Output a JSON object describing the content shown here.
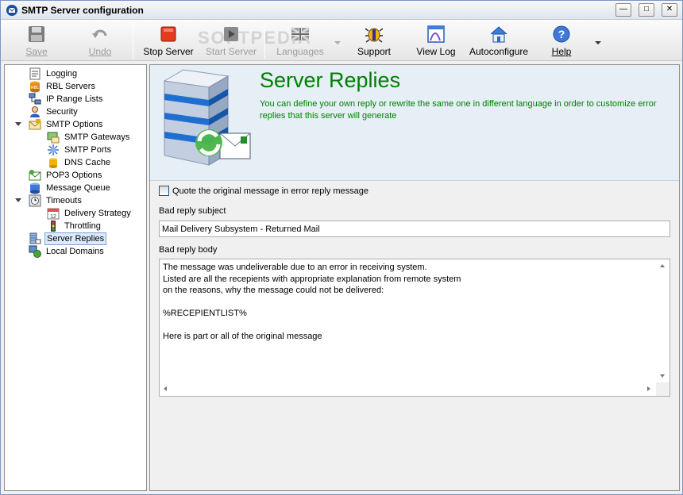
{
  "window": {
    "title": "SMTP Server configuration"
  },
  "toolbar": {
    "watermark": "SOFTPEDIA",
    "buttons": [
      {
        "id": "save",
        "label": "Save",
        "icon": "floppy-disk-icon",
        "enabled": false
      },
      {
        "id": "undo",
        "label": "Undo",
        "icon": "undo-arrow-icon",
        "enabled": false
      },
      {
        "id": "stop-server",
        "label": "Stop Server",
        "icon": "stop-icon",
        "enabled": true
      },
      {
        "id": "start-server",
        "label": "Start Server",
        "icon": "play-icon",
        "enabled": false
      },
      {
        "id": "languages",
        "label": "Languages",
        "icon": "uk-flag-icon",
        "enabled": false
      },
      {
        "id": "support",
        "label": "Support",
        "icon": "bug-icon",
        "enabled": true
      },
      {
        "id": "view-log",
        "label": "View Log",
        "icon": "log-window-icon",
        "enabled": true
      },
      {
        "id": "autoconfigure",
        "label": "Autoconfigure",
        "icon": "house-icon",
        "enabled": true
      },
      {
        "id": "help",
        "label": "Help",
        "icon": "help-icon",
        "enabled": true
      }
    ]
  },
  "tree": {
    "items": [
      {
        "label": "Logging"
      },
      {
        "label": "RBL Servers"
      },
      {
        "label": "IP Range Lists"
      },
      {
        "label": "Security"
      },
      {
        "label": "SMTP Options"
      },
      {
        "label": "SMTP Gateways"
      },
      {
        "label": "SMTP Ports"
      },
      {
        "label": "DNS Cache"
      },
      {
        "label": "POP3 Options"
      },
      {
        "label": "Message Queue"
      },
      {
        "label": "Timeouts"
      },
      {
        "label": "Delivery Strategy"
      },
      {
        "label": "Throttling"
      },
      {
        "label": "Server Replies"
      },
      {
        "label": "Local Domains"
      }
    ],
    "selected": "Server Replies"
  },
  "panel": {
    "title": "Server Replies",
    "description": "You can define your own reply or rewrite the same one in different language in order to customize error replies that this server will generate",
    "quote_checkbox_label": "Quote the original message in error reply message",
    "quote_checked": false,
    "subject_label": "Bad reply subject",
    "subject_value": "Mail Delivery Subsystem - Returned Mail",
    "body_label": "Bad reply body",
    "body_value": "The message was undeliverable due to an error in receiving system.\nListed are all the recepients with appropriate explanation from remote system\non the reasons, why the message could not be delivered:\n\n%RECEPIENTLIST%\n\nHere is part or all of the original message"
  },
  "colors": {
    "accent_green": "#008000",
    "header_bg": "#e6eef6",
    "selection": "#dcebfc"
  }
}
